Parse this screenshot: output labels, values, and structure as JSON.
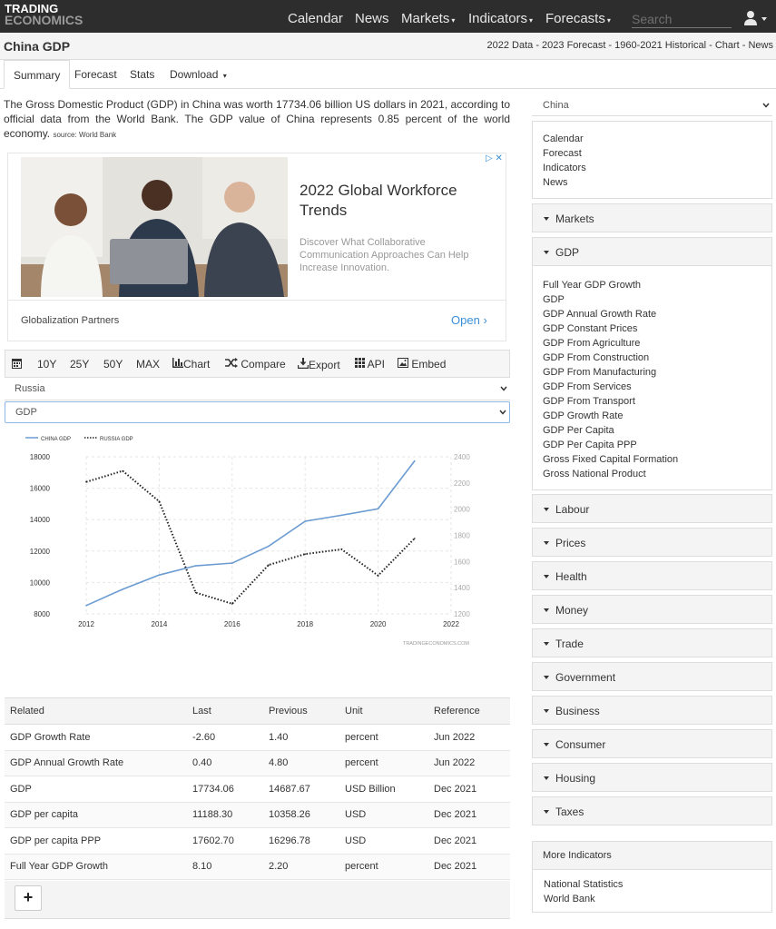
{
  "logo": {
    "line1": "TRADING",
    "line2": "ECONOMICS"
  },
  "nav": {
    "items": [
      {
        "label": "Calendar",
        "caret": ""
      },
      {
        "label": "News",
        "caret": ""
      },
      {
        "label": "Markets",
        "caret": "▾"
      },
      {
        "label": "Indicators",
        "caret": "▾"
      },
      {
        "label": "Forecasts",
        "caret": "▾"
      }
    ],
    "search_placeholder": "Search",
    "user_icon": "user-icon"
  },
  "header": {
    "title": "China GDP",
    "subtitle": "2022 Data - 2023 Forecast - 1960-2021 Historical - Chart - News"
  },
  "tabs": [
    "Summary",
    "Forecast",
    "Stats",
    "Download"
  ],
  "download_caret": "▾",
  "description": {
    "text": "The Gross Domestic Product (GDP) in China was worth 17734.06 billion US dollars in 2021, according to official data from the World Bank. The GDP value of China represents 0.85 percent of the world economy.",
    "source": "source: World Bank"
  },
  "ad": {
    "headline": "2022 Global Workforce Trends",
    "body": "Discover What Collaborative Communication Approaches Can Help Increase Innovation.",
    "brand": "Globalization Partners",
    "cta": "Open",
    "cta_chevron": "›"
  },
  "chart_toolbar": {
    "ranges": [
      "10Y",
      "25Y",
      "50Y",
      "MAX"
    ],
    "chart": "Chart",
    "compare": "Compare",
    "export": "Export",
    "api": "API",
    "embed": "Embed"
  },
  "selects": {
    "country": "Russia",
    "indicator": "GDP"
  },
  "chart_data": {
    "type": "line",
    "x": [
      2012,
      2013,
      2014,
      2015,
      2016,
      2017,
      2018,
      2019,
      2020,
      2021
    ],
    "series": [
      {
        "name": "CHINA GDP",
        "axis": "left",
        "color": "#6b9bd1",
        "style": "solid",
        "values": [
          8532,
          9570,
          10476,
          11062,
          11233,
          12310,
          13895,
          14280,
          14688,
          17734
        ]
      },
      {
        "name": "RUSSIA GDP",
        "axis": "right",
        "color": "#222222",
        "style": "dotted",
        "values": [
          2208,
          2292,
          2059,
          1363,
          1277,
          1574,
          1657,
          1693,
          1493,
          1776
        ]
      }
    ],
    "ylim_left": [
      8000,
      18000
    ],
    "yticks_left": [
      8000,
      10000,
      12000,
      14000,
      16000,
      18000
    ],
    "ylim_right": [
      1200,
      2400
    ],
    "yticks_right": [
      1200,
      1400,
      1600,
      1800,
      2000,
      2200,
      2400
    ],
    "xlim": [
      2012,
      2022
    ],
    "xticks": [
      2012,
      2014,
      2016,
      2018,
      2020,
      2022
    ],
    "grid": true,
    "legend": "top-left",
    "watermark": "TRADINGECONOMICS.COM"
  },
  "related": {
    "headers": [
      "Related",
      "Last",
      "Previous",
      "Unit",
      "Reference"
    ],
    "rows": [
      [
        "GDP Growth Rate",
        "-2.60",
        "1.40",
        "percent",
        "Jun 2022"
      ],
      [
        "GDP Annual Growth Rate",
        "0.40",
        "4.80",
        "percent",
        "Jun 2022"
      ],
      [
        "GDP",
        "17734.06",
        "14687.67",
        "USD Billion",
        "Dec 2021"
      ],
      [
        "GDP per capita",
        "11188.30",
        "10358.26",
        "USD",
        "Dec 2021"
      ],
      [
        "GDP per capita PPP",
        "17602.70",
        "16296.78",
        "USD",
        "Dec 2021"
      ],
      [
        "Full Year GDP Growth",
        "8.10",
        "2.20",
        "percent",
        "Dec 2021"
      ]
    ],
    "plus": "+"
  },
  "sidebar": {
    "country": "China",
    "links": [
      "Calendar",
      "Forecast",
      "Indicators",
      "News"
    ],
    "markets": "Markets",
    "gdp": "GDP",
    "gdp_links": [
      "Full Year GDP Growth",
      "GDP",
      "GDP Annual Growth Rate",
      "GDP Constant Prices",
      "GDP From Agriculture",
      "GDP From Construction",
      "GDP From Manufacturing",
      "GDP From Services",
      "GDP From Transport",
      "GDP Growth Rate",
      "GDP Per Capita",
      "GDP Per Capita PPP",
      "Gross Fixed Capital Formation",
      "Gross National Product"
    ],
    "sections": [
      "Labour",
      "Prices",
      "Health",
      "Money",
      "Trade",
      "Government",
      "Business",
      "Consumer",
      "Housing",
      "Taxes"
    ],
    "more_title": "More Indicators",
    "more_links": [
      "National Statistics",
      "World Bank"
    ]
  }
}
